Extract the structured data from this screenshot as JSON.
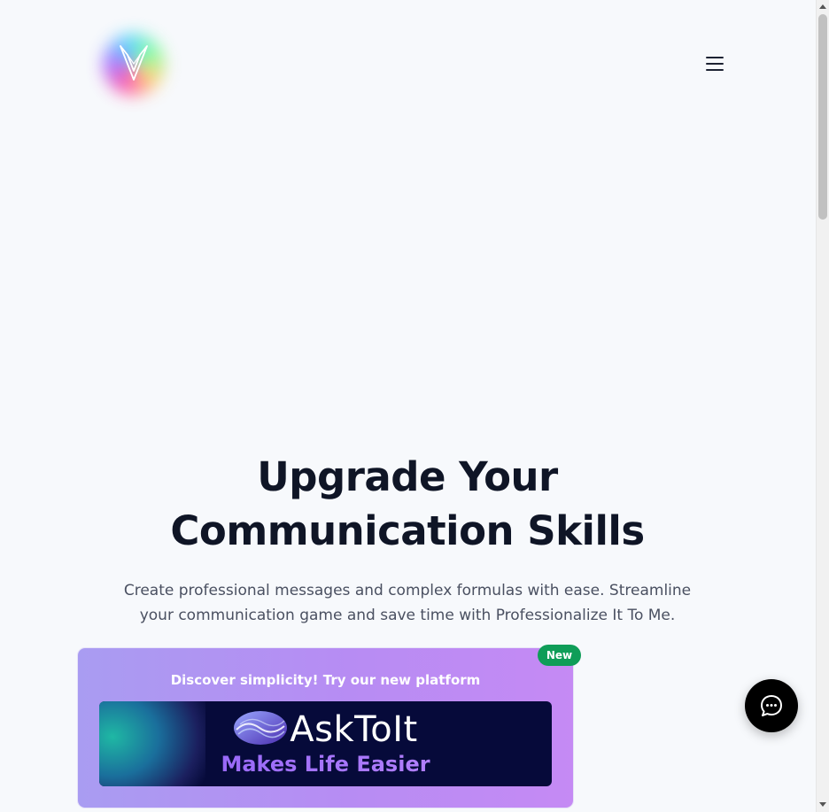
{
  "header": {
    "logo_icon": "v-brand-logo-icon",
    "menu_icon": "hamburger-menu-icon"
  },
  "hero": {
    "title": "Upgrade Your Communication Skills",
    "subtitle": "Create professional messages and complex formulas with ease. Streamline your communication game and save time with Professionalize It To Me."
  },
  "promo": {
    "badge": "New",
    "text": "Discover simplicity! Try our new platform",
    "banner_brand": "AskToIt",
    "banner_tagline": "Makes Life Easier",
    "colors": {
      "card_gradient_start": "#a99cf2",
      "card_gradient_end": "#c58af4",
      "badge": "#0f9d58",
      "banner_bg": "#060a3a"
    }
  },
  "chat": {
    "icon": "chat-bubble-icon",
    "color": "#000000"
  }
}
